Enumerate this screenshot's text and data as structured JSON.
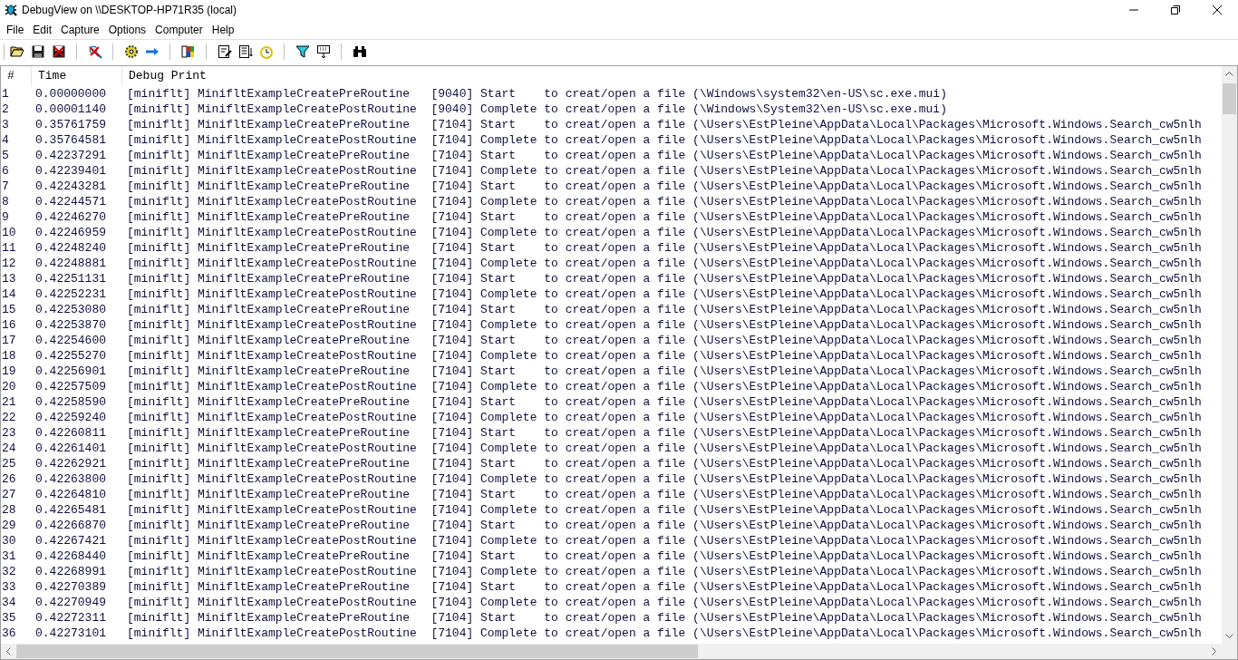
{
  "window": {
    "title": "DebugView on \\\\DESKTOP-HP71R35 (local)"
  },
  "menu": [
    "File",
    "Edit",
    "Capture",
    "Options",
    "Computer",
    "Help"
  ],
  "table": {
    "columns": [
      "#",
      "Time",
      "Debug Print"
    ],
    "rows": [
      {
        "num": "1",
        "time": "0.00000000",
        "text": "[miniflt] MinifltExampleCreatePreRoutine   [9040] Start    to creat/open a file (\\Windows\\system32\\en-US\\sc.exe.mui)"
      },
      {
        "num": "2",
        "time": "0.00001140",
        "text": "[miniflt] MinifltExampleCreatePostRoutine  [9040] Complete to creat/open a file (\\Windows\\System32\\en-US\\sc.exe.mui)"
      },
      {
        "num": "3",
        "time": "0.35761759",
        "text": "[miniflt] MinifltExampleCreatePreRoutine   [7104] Start    to creat/open a file (\\Users\\EstPleine\\AppData\\Local\\Packages\\Microsoft.Windows.Search_cw5nlh"
      },
      {
        "num": "4",
        "time": "0.35764581",
        "text": "[miniflt] MinifltExampleCreatePostRoutine  [7104] Complete to creat/open a file (\\Users\\EstPleine\\AppData\\Local\\Packages\\Microsoft.Windows.Search_cw5nlh"
      },
      {
        "num": "5",
        "time": "0.42237291",
        "text": "[miniflt] MinifltExampleCreatePreRoutine   [7104] Start    to creat/open a file (\\Users\\EstPleine\\AppData\\Local\\Packages\\Microsoft.Windows.Search_cw5nlh"
      },
      {
        "num": "6",
        "time": "0.42239401",
        "text": "[miniflt] MinifltExampleCreatePostRoutine  [7104] Complete to creat/open a file (\\Users\\EstPleine\\AppData\\Local\\Packages\\Microsoft.Windows.Search_cw5nlh"
      },
      {
        "num": "7",
        "time": "0.42243281",
        "text": "[miniflt] MinifltExampleCreatePreRoutine   [7104] Start    to creat/open a file (\\Users\\EstPleine\\AppData\\Local\\Packages\\Microsoft.Windows.Search_cw5nlh"
      },
      {
        "num": "8",
        "time": "0.42244571",
        "text": "[miniflt] MinifltExampleCreatePostRoutine  [7104] Complete to creat/open a file (\\Users\\EstPleine\\AppData\\Local\\Packages\\Microsoft.Windows.Search_cw5nlh"
      },
      {
        "num": "9",
        "time": "0.42246270",
        "text": "[miniflt] MinifltExampleCreatePreRoutine   [7104] Start    to creat/open a file (\\Users\\EstPleine\\AppData\\Local\\Packages\\Microsoft.Windows.Search_cw5nlh"
      },
      {
        "num": "10",
        "time": "0.42246959",
        "text": "[miniflt] MinifltExampleCreatePostRoutine  [7104] Complete to creat/open a file (\\Users\\EstPleine\\AppData\\Local\\Packages\\Microsoft.Windows.Search_cw5nlh"
      },
      {
        "num": "11",
        "time": "0.42248240",
        "text": "[miniflt] MinifltExampleCreatePreRoutine   [7104] Start    to creat/open a file (\\Users\\EstPleine\\AppData\\Local\\Packages\\Microsoft.Windows.Search_cw5nlh"
      },
      {
        "num": "12",
        "time": "0.42248881",
        "text": "[miniflt] MinifltExampleCreatePostRoutine  [7104] Complete to creat/open a file (\\Users\\EstPleine\\AppData\\Local\\Packages\\Microsoft.Windows.Search_cw5nlh"
      },
      {
        "num": "13",
        "time": "0.42251131",
        "text": "[miniflt] MinifltExampleCreatePreRoutine   [7104] Start    to creat/open a file (\\Users\\EstPleine\\AppData\\Local\\Packages\\Microsoft.Windows.Search_cw5nlh"
      },
      {
        "num": "14",
        "time": "0.42252231",
        "text": "[miniflt] MinifltExampleCreatePostRoutine  [7104] Complete to creat/open a file (\\Users\\EstPleine\\AppData\\Local\\Packages\\Microsoft.Windows.Search_cw5nlh"
      },
      {
        "num": "15",
        "time": "0.42253080",
        "text": "[miniflt] MinifltExampleCreatePreRoutine   [7104] Start    to creat/open a file (\\Users\\EstPleine\\AppData\\Local\\Packages\\Microsoft.Windows.Search_cw5nlh"
      },
      {
        "num": "16",
        "time": "0.42253870",
        "text": "[miniflt] MinifltExampleCreatePostRoutine  [7104] Complete to creat/open a file (\\Users\\EstPleine\\AppData\\Local\\Packages\\Microsoft.Windows.Search_cw5nlh"
      },
      {
        "num": "17",
        "time": "0.42254600",
        "text": "[miniflt] MinifltExampleCreatePreRoutine   [7104] Start    to creat/open a file (\\Users\\EstPleine\\AppData\\Local\\Packages\\Microsoft.Windows.Search_cw5nlh"
      },
      {
        "num": "18",
        "time": "0.42255270",
        "text": "[miniflt] MinifltExampleCreatePostRoutine  [7104] Complete to creat/open a file (\\Users\\EstPleine\\AppData\\Local\\Packages\\Microsoft.Windows.Search_cw5nlh"
      },
      {
        "num": "19",
        "time": "0.42256901",
        "text": "[miniflt] MinifltExampleCreatePreRoutine   [7104] Start    to creat/open a file (\\Users\\EstPleine\\AppData\\Local\\Packages\\Microsoft.Windows.Search_cw5nlh"
      },
      {
        "num": "20",
        "time": "0.42257509",
        "text": "[miniflt] MinifltExampleCreatePostRoutine  [7104] Complete to creat/open a file (\\Users\\EstPleine\\AppData\\Local\\Packages\\Microsoft.Windows.Search_cw5nlh"
      },
      {
        "num": "21",
        "time": "0.42258590",
        "text": "[miniflt] MinifltExampleCreatePreRoutine   [7104] Start    to creat/open a file (\\Users\\EstPleine\\AppData\\Local\\Packages\\Microsoft.Windows.Search_cw5nlh"
      },
      {
        "num": "22",
        "time": "0.42259240",
        "text": "[miniflt] MinifltExampleCreatePostRoutine  [7104] Complete to creat/open a file (\\Users\\EstPleine\\AppData\\Local\\Packages\\Microsoft.Windows.Search_cw5nlh"
      },
      {
        "num": "23",
        "time": "0.42260811",
        "text": "[miniflt] MinifltExampleCreatePreRoutine   [7104] Start    to creat/open a file (\\Users\\EstPleine\\AppData\\Local\\Packages\\Microsoft.Windows.Search_cw5nlh"
      },
      {
        "num": "24",
        "time": "0.42261401",
        "text": "[miniflt] MinifltExampleCreatePostRoutine  [7104] Complete to creat/open a file (\\Users\\EstPleine\\AppData\\Local\\Packages\\Microsoft.Windows.Search_cw5nlh"
      },
      {
        "num": "25",
        "time": "0.42262921",
        "text": "[miniflt] MinifltExampleCreatePreRoutine   [7104] Start    to creat/open a file (\\Users\\EstPleine\\AppData\\Local\\Packages\\Microsoft.Windows.Search_cw5nlh"
      },
      {
        "num": "26",
        "time": "0.42263800",
        "text": "[miniflt] MinifltExampleCreatePostRoutine  [7104] Complete to creat/open a file (\\Users\\EstPleine\\AppData\\Local\\Packages\\Microsoft.Windows.Search_cw5nlh"
      },
      {
        "num": "27",
        "time": "0.42264810",
        "text": "[miniflt] MinifltExampleCreatePreRoutine   [7104] Start    to creat/open a file (\\Users\\EstPleine\\AppData\\Local\\Packages\\Microsoft.Windows.Search_cw5nlh"
      },
      {
        "num": "28",
        "time": "0.42265481",
        "text": "[miniflt] MinifltExampleCreatePostRoutine  [7104] Complete to creat/open a file (\\Users\\EstPleine\\AppData\\Local\\Packages\\Microsoft.Windows.Search_cw5nlh"
      },
      {
        "num": "29",
        "time": "0.42266870",
        "text": "[miniflt] MinifltExampleCreatePreRoutine   [7104] Start    to creat/open a file (\\Users\\EstPleine\\AppData\\Local\\Packages\\Microsoft.Windows.Search_cw5nlh"
      },
      {
        "num": "30",
        "time": "0.42267421",
        "text": "[miniflt] MinifltExampleCreatePostRoutine  [7104] Complete to creat/open a file (\\Users\\EstPleine\\AppData\\Local\\Packages\\Microsoft.Windows.Search_cw5nlh"
      },
      {
        "num": "31",
        "time": "0.42268440",
        "text": "[miniflt] MinifltExampleCreatePreRoutine   [7104] Start    to creat/open a file (\\Users\\EstPleine\\AppData\\Local\\Packages\\Microsoft.Windows.Search_cw5nlh"
      },
      {
        "num": "32",
        "time": "0.42268991",
        "text": "[miniflt] MinifltExampleCreatePostRoutine  [7104] Complete to creat/open a file (\\Users\\EstPleine\\AppData\\Local\\Packages\\Microsoft.Windows.Search_cw5nlh"
      },
      {
        "num": "33",
        "time": "0.42270389",
        "text": "[miniflt] MinifltExampleCreatePreRoutine   [7104] Start    to creat/open a file (\\Users\\EstPleine\\AppData\\Local\\Packages\\Microsoft.Windows.Search_cw5nlh"
      },
      {
        "num": "34",
        "time": "0.42270949",
        "text": "[miniflt] MinifltExampleCreatePostRoutine  [7104] Complete to creat/open a file (\\Users\\EstPleine\\AppData\\Local\\Packages\\Microsoft.Windows.Search_cw5nlh"
      },
      {
        "num": "35",
        "time": "0.42272311",
        "text": "[miniflt] MinifltExampleCreatePreRoutine   [7104] Start    to creat/open a file (\\Users\\EstPleine\\AppData\\Local\\Packages\\Microsoft.Windows.Search_cw5nlh"
      },
      {
        "num": "36",
        "time": "0.42273101",
        "text": "[miniflt] MinifltExampleCreatePostRoutine  [7104] Complete to creat/open a file (\\Users\\EstPleine\\AppData\\Local\\Packages\\Microsoft.Windows.Search_cw5nlh"
      }
    ]
  }
}
